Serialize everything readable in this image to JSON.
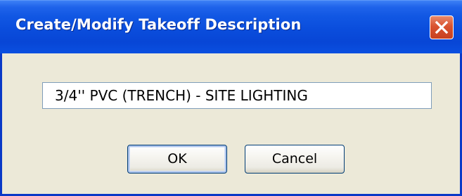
{
  "dialog": {
    "title": "Create/Modify Takeoff Description",
    "close_icon": "close-x-icon",
    "description_value": "3/4'' PVC (TRENCH) - SITE LIGHTING",
    "ok_label": "OK",
    "cancel_label": "Cancel"
  },
  "colors": {
    "titlebar": "#0a4ddc",
    "client_background": "#ece9d8",
    "close_button": "#d9532f"
  }
}
